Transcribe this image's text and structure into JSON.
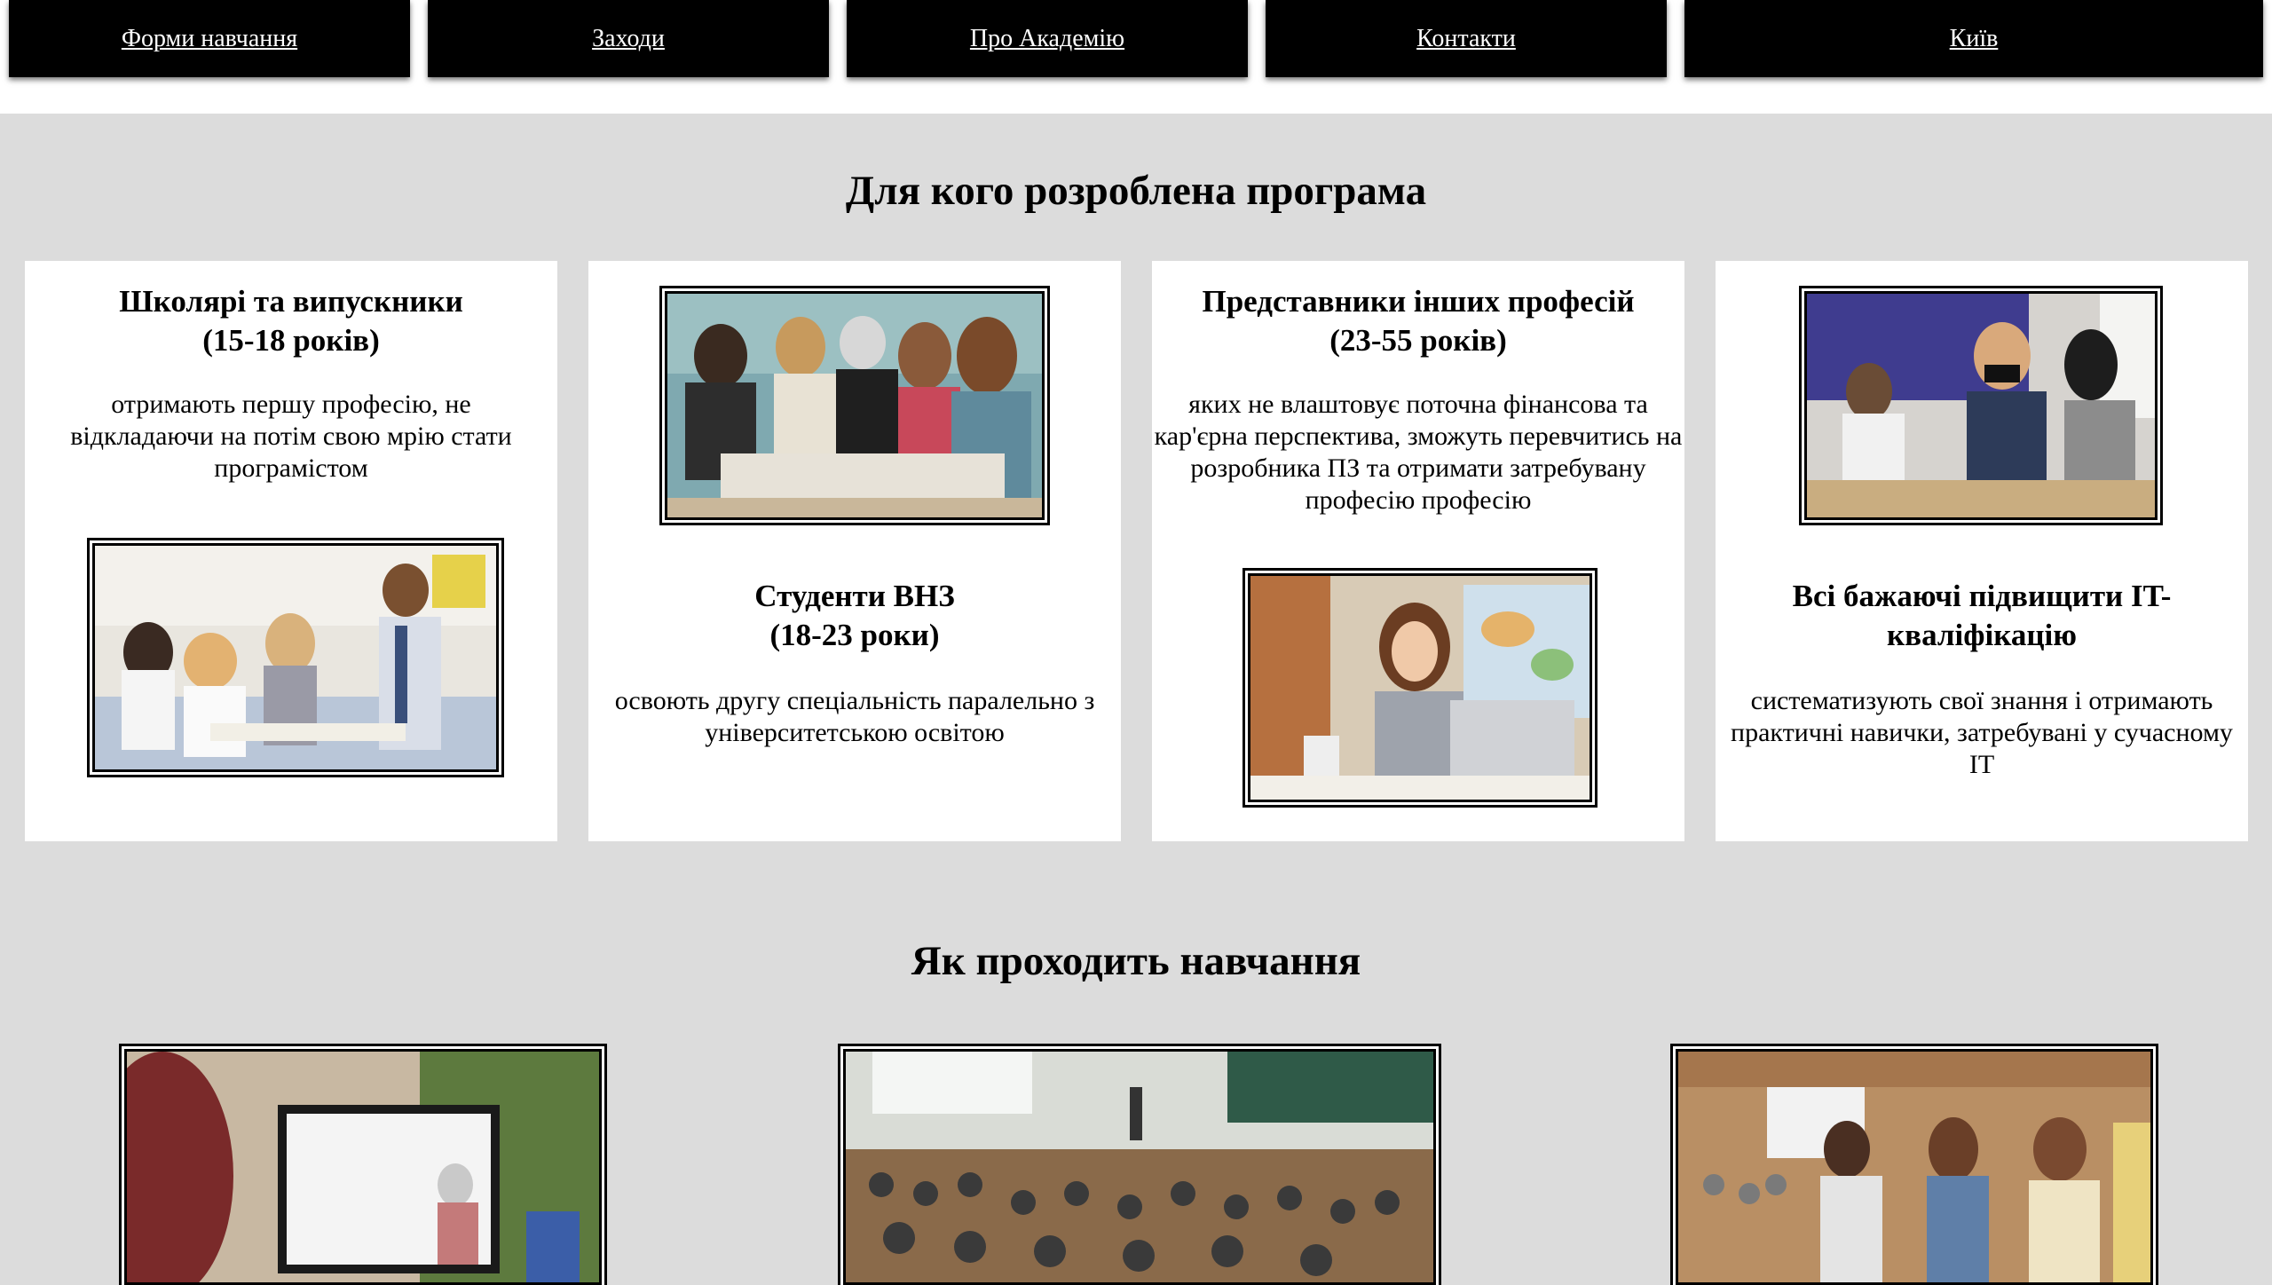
{
  "nav": {
    "items": [
      {
        "label": "Форми навчання"
      },
      {
        "label": "Заходи"
      },
      {
        "label": "Про Академію"
      },
      {
        "label": "Контакти"
      },
      {
        "label": "Київ"
      }
    ]
  },
  "audience": {
    "title": "Для кого розроблена програма",
    "cards": [
      {
        "title_line1": "Школярі та випускники",
        "title_line2": "(15-18 років)",
        "text": "отримають першу професію, не відкладаючи на потім свою мрію стати програмістом"
      },
      {
        "title_line1": "Студенти ВНЗ",
        "title_line2": "(18-23 роки)",
        "text": "освоють другу спеціальність паралельно з університетською освітою"
      },
      {
        "title_line1": "Представники інших професій",
        "title_line2": "(23-55 років)",
        "text": "яких не влаштовує поточна фінансова та кар'єрна перспектива, зможуть перевчитись на розробника ПЗ та отримати затребувану професію професію"
      },
      {
        "title_line1": "Всі бажаючі підвищити IT-",
        "title_line2": "кваліфікацію",
        "text": "систематизують свої знання і отримають практичні навички, затребувані у сучасному IT"
      }
    ]
  },
  "learning": {
    "title": "Як проходить навчання"
  },
  "colors": {
    "background": "#dcdcdc",
    "nav_bg": "#000000",
    "card_bg": "#ffffff"
  }
}
